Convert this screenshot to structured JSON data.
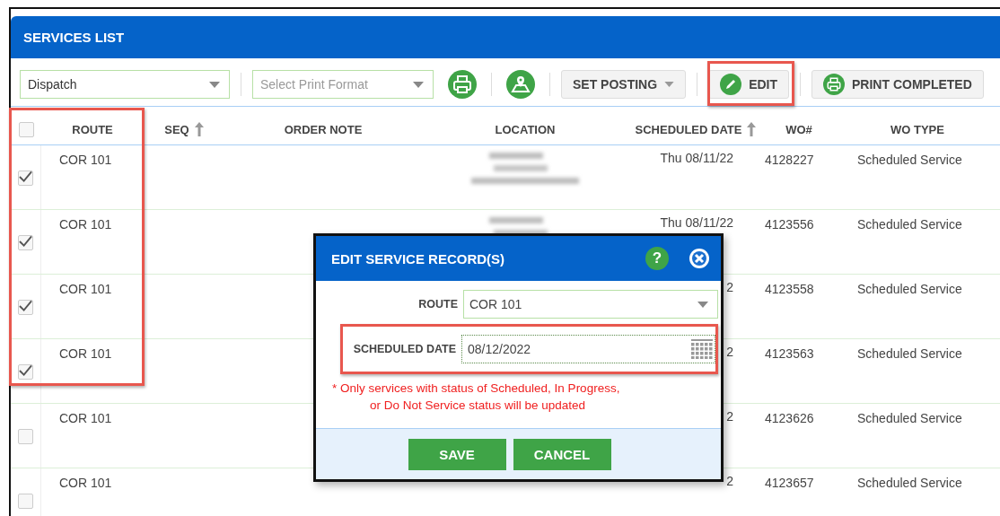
{
  "window": {
    "title": "SERVICES LIST"
  },
  "toolbar": {
    "view_select": {
      "value": "Dispatch"
    },
    "print_format_select": {
      "placeholder": "Select Print Format"
    },
    "set_posting": "SET POSTING",
    "edit": "EDIT",
    "print_completed": "PRINT COMPLETED"
  },
  "table": {
    "select_all_checked": false,
    "columns": [
      {
        "label": "ROUTE",
        "sorted": false
      },
      {
        "label": "SEQ",
        "sorted": true
      },
      {
        "label": "ORDER NOTE",
        "sorted": false
      },
      {
        "label": "LOCATION",
        "sorted": false
      },
      {
        "label": "SCHEDULED DATE",
        "sorted": true
      },
      {
        "label": "WO#",
        "sorted": false
      },
      {
        "label": "WO TYPE",
        "sorted": false
      }
    ],
    "rows": [
      {
        "checked": true,
        "route": "COR 101",
        "scheduled_date": "Thu 08/11/22",
        "wo": "4128227",
        "wo_type": "Scheduled Service"
      },
      {
        "checked": true,
        "route": "COR 101",
        "scheduled_date": "Thu 08/11/22",
        "wo": "4123556",
        "wo_type": "Scheduled Service"
      },
      {
        "checked": true,
        "route": "COR 101",
        "scheduled_date": "2",
        "wo": "4123558",
        "wo_type": "Scheduled Service"
      },
      {
        "checked": true,
        "route": "COR 101",
        "scheduled_date": "2",
        "wo": "4123563",
        "wo_type": "Scheduled Service"
      },
      {
        "checked": false,
        "route": "COR 101",
        "scheduled_date": "2",
        "wo": "4123626",
        "wo_type": "Scheduled Service"
      },
      {
        "checked": false,
        "route": "COR 101",
        "scheduled_date": "2",
        "wo": "4123657",
        "wo_type": "Scheduled Service"
      }
    ]
  },
  "dialog": {
    "title": "EDIT SERVICE RECORD(S)",
    "help": "?",
    "route_label": "ROUTE",
    "route_value": "COR 101",
    "date_label": "SCHEDULED DATE",
    "date_value": "08/12/2022",
    "note_lines": [
      "* Only services with status of Scheduled, In Progress,",
      "or Do Not Service status will be updated"
    ],
    "buttons": [
      "SAVE",
      "CANCEL"
    ]
  }
}
